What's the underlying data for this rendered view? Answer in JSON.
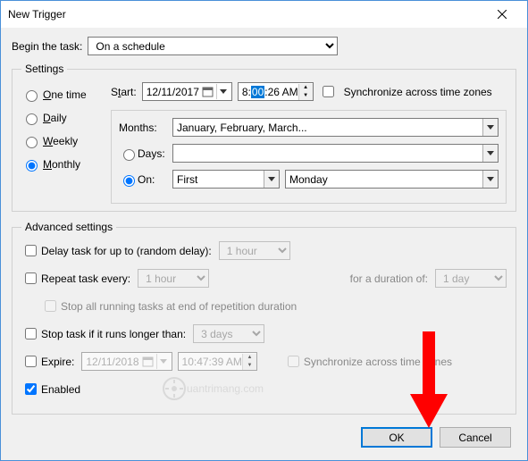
{
  "window": {
    "title": "New Trigger"
  },
  "begin": {
    "label": "Begin the task:",
    "value": "On a schedule"
  },
  "settings": {
    "legend": "Settings",
    "freq": {
      "one_time": "One time",
      "daily": "Daily",
      "weekly": "Weekly",
      "monthly": "Monthly",
      "selected": "monthly"
    },
    "start": {
      "label": "Start:",
      "date": "12/11/2017",
      "time_h": "8:",
      "time_m_sel": "00",
      "time_rest": ":26 AM",
      "sync_label": "Synchronize across time zones"
    },
    "months": {
      "label": "Months:",
      "value": "January, February, March..."
    },
    "days": {
      "label": "Days:",
      "value": ""
    },
    "on": {
      "label": "On:",
      "week": "First",
      "day": "Monday",
      "selected": "on"
    }
  },
  "advanced": {
    "legend": "Advanced settings",
    "delay": {
      "label": "Delay task for up to (random delay):",
      "value": "1 hour"
    },
    "repeat": {
      "label": "Repeat task every:",
      "value": "1 hour",
      "duration_label": "for a duration of:",
      "duration_value": "1 day"
    },
    "stop_all": "Stop all running tasks at end of repetition duration",
    "stop_if": {
      "label": "Stop task if it runs longer than:",
      "value": "3 days"
    },
    "expire": {
      "label": "Expire:",
      "date": "12/11/2018",
      "time": "10:47:39 AM",
      "sync": "Synchronize across time zones"
    },
    "enabled": "Enabled"
  },
  "buttons": {
    "ok": "OK",
    "cancel": "Cancel"
  },
  "watermark": "uantrimang.com"
}
